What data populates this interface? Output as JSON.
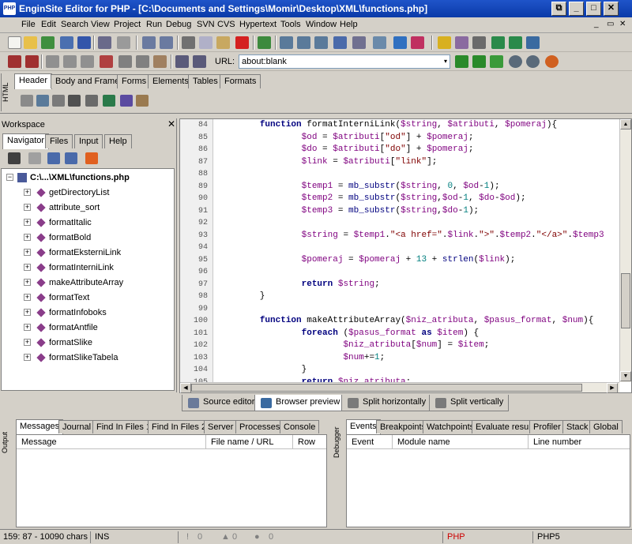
{
  "window": {
    "title": "EnginSite Editor for PHP - [C:\\Documents and Settings\\Momir\\Desktop\\XML\\functions.php]",
    "app_icon": "PHP",
    "buttons": [
      "⧉",
      "_",
      "□",
      "✕"
    ]
  },
  "menu": {
    "items": [
      "File",
      "Edit",
      "Search",
      "View",
      "Project",
      "Run",
      "Debug",
      "SVN",
      "CVS",
      "Hypertext",
      "Tools",
      "Window",
      "Help"
    ],
    "mdi_buttons": [
      "_",
      "▭",
      "✕"
    ]
  },
  "url_bar": {
    "label": "URL:",
    "value": "about:blank"
  },
  "html_panel": {
    "side_label": "HTML",
    "tabs": [
      "Header",
      "Body and Frames",
      "Forms",
      "Elements",
      "Tables",
      "Formats"
    ],
    "active_tab": "Header"
  },
  "workspace": {
    "title": "Workspace",
    "close": "✕",
    "tabs": [
      "Navigator",
      "Files",
      "Input",
      "Help"
    ],
    "root": "C:\\...\\XML\\functions.php",
    "items": [
      "getDirectoryList",
      "attribute_sort",
      "formatItalic",
      "formatBold",
      "formatEksterniLink",
      "formatInterniLink",
      "makeAttributeArray",
      "formatText",
      "formatInfoboks",
      "formatAntfile",
      "formatSlike",
      "formatSlikeTabela"
    ]
  },
  "editor": {
    "lines": [
      {
        "n": "84",
        "code": "        function formatInterniLink($string, $atributi, $pomeraj){"
      },
      {
        "n": "85",
        "code": "                $od = $atributi[\"od\"] + $pomeraj;"
      },
      {
        "n": "86",
        "code": "                $do = $atributi[\"do\"] + $pomeraj;"
      },
      {
        "n": "87",
        "code": "                $link = $atributi[\"link\"];"
      },
      {
        "n": "88",
        "code": ""
      },
      {
        "n": "89",
        "code": "                $temp1 = mb_substr($string, 0, $od-1);"
      },
      {
        "n": "90",
        "code": "                $temp2 = mb_substr($string,$od-1, $do-$od);"
      },
      {
        "n": "91",
        "code": "                $temp3 = mb_substr($string,$do-1);"
      },
      {
        "n": "92",
        "code": ""
      },
      {
        "n": "93",
        "code": "                $string = $temp1.\"<a href=\".$link.\">\".$temp2.\"</a>\".$temp3"
      },
      {
        "n": "94",
        "code": ""
      },
      {
        "n": "95",
        "code": "                $pomeraj = $pomeraj + 13 + strlen($link);"
      },
      {
        "n": "96",
        "code": ""
      },
      {
        "n": "97",
        "code": "                return $string;"
      },
      {
        "n": "98",
        "code": "        }"
      },
      {
        "n": "99",
        "code": ""
      },
      {
        "n": "100",
        "code": "        function makeAttributeArray($niz_atributa, $pasus_format, $num){"
      },
      {
        "n": "101",
        "code": "                foreach ($pasus_format as $item) {"
      },
      {
        "n": "102",
        "code": "                        $niz_atributa[$num] = $item;"
      },
      {
        "n": "103",
        "code": "                        $num+=1;"
      },
      {
        "n": "104",
        "code": "                }"
      },
      {
        "n": "105",
        "code": "                return $niz_atributa;"
      }
    ]
  },
  "view_tabs": [
    "Source editor",
    "Browser preview",
    "Split horizontally",
    "Split vertically"
  ],
  "output": {
    "side_label": "Output",
    "tabs": [
      "Messages",
      "Journal",
      "Find In Files 1",
      "Find In Files 2",
      "Server",
      "Processes",
      "Console"
    ],
    "columns": [
      "Message",
      "File name / URL",
      "Row"
    ]
  },
  "debugger": {
    "side_label": "Debugger",
    "tabs": [
      "Events",
      "Breakpoints",
      "Watchpoints",
      "Evaluate results",
      "Profiler",
      "Stack",
      "Global"
    ],
    "columns": [
      "Event",
      "Module name",
      "Line number"
    ]
  },
  "status": {
    "position": "159: 87 - 10090 chars",
    "mode": "INS",
    "count1": "0",
    "count2": "0",
    "count3": "0",
    "lang": "PHP",
    "version": "PHP5"
  },
  "colors": {
    "title_bar": "#0a3aa8",
    "keyword": "#00007f",
    "variable": "#7f007f",
    "string": "#7f0000",
    "status_php": "#cc0000"
  }
}
